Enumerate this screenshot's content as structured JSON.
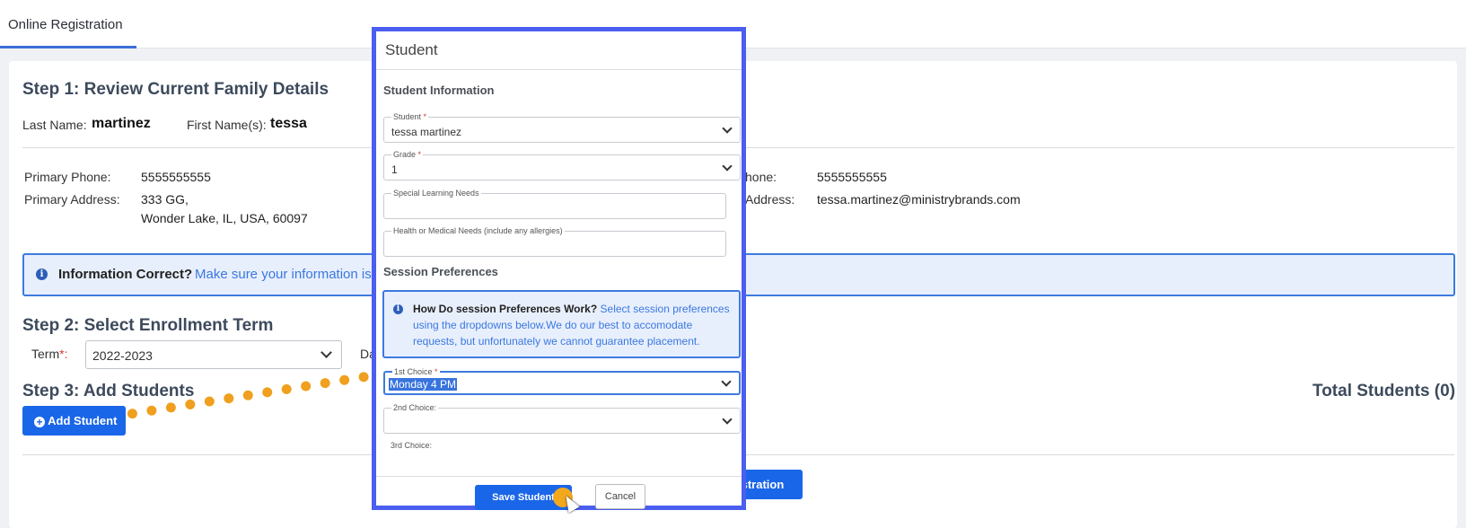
{
  "tabs": {
    "active": "Online Registration"
  },
  "step1": {
    "title": "Step 1: Review Current Family Details",
    "last_name_label": "Last Name:",
    "last_name": "martinez",
    "first_name_label": "First Name(s):",
    "first_name": "tessa",
    "primary_phone_label": "Primary Phone:",
    "primary_phone": "5555555555",
    "primary_address_label": "Primary Address:",
    "address_line1": "333 GG,",
    "address_line2": "Wonder Lake, IL, USA, 60097",
    "phone2_label_fragment": "hone:",
    "phone2": "5555555555",
    "address2_label_fragment": "Address:",
    "email": "tessa.martinez@ministrybrands.com"
  },
  "info_bar": {
    "title": "Information Correct?",
    "text": "Make sure your information is"
  },
  "step2": {
    "title": "Step 2: Select Enrollment Term",
    "term_label": "Term",
    "term_required": "*:",
    "term_value": "2022-2023",
    "fragment": "Da"
  },
  "step3": {
    "title": "Step 3: Add Students",
    "add_button": "Add Student",
    "total": "Total Students (0)",
    "submit_fragment": "istration"
  },
  "modal": {
    "title": "Student",
    "student_info": "Student Information",
    "student_label": "Student",
    "student_value": "tessa martinez",
    "grade_label": "Grade",
    "grade_value": "1",
    "special_label": "Special Learning Needs",
    "health_label": "Health or Medical Needs (include any allergies)",
    "session_prefs": "Session Preferences",
    "pref_title": "How Do session Preferences Work?",
    "pref_text": "Select session preferences using the dropdowns below.We do our best to accomodate requests, but unfortunately we cannot guarantee placement.",
    "first_choice_label": "1st Choice",
    "first_choice_value": "Monday 4 PM",
    "second_choice_label": "2nd Choice:",
    "third_choice_label": "3rd Choice:",
    "required_mark": "*",
    "save": "Save Student",
    "cancel": "Cancel"
  },
  "icons": {
    "info": "info-icon",
    "add": "plus-circle-icon",
    "chevron": "chevron-down-icon"
  },
  "colors": {
    "accent": "#1a66e8",
    "modal_border": "#4a5ef0",
    "highlight": "#f2a81d"
  }
}
